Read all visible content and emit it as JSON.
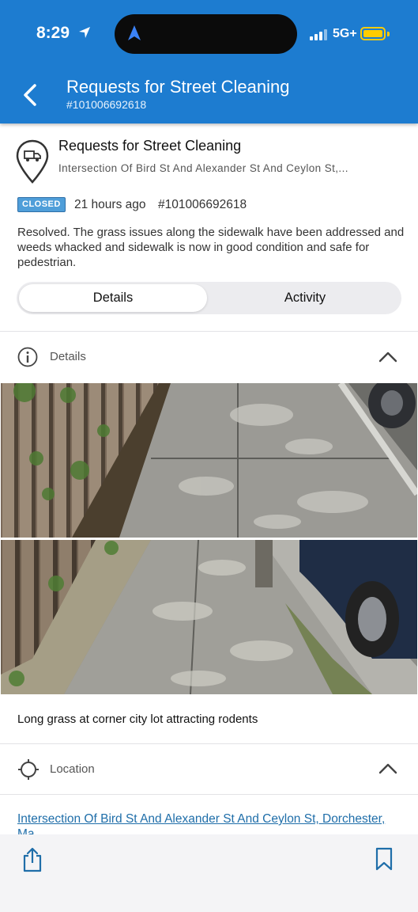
{
  "status_bar": {
    "time": "8:29",
    "network": "5G+"
  },
  "header": {
    "title": "Requests for Street Cleaning",
    "subtitle": "#101006692618"
  },
  "request": {
    "title": "Requests for Street Cleaning",
    "address": "Intersection Of Bird St And Alexander St And Ceylon St,...",
    "status_badge": "CLOSED",
    "time_ago": "21 hours ago",
    "request_id": "#101006692618",
    "resolution_text": "Resolved. The grass issues along the sidewalk  have been addressed and weeds whacked  and sidewalk  is now in good condition and safe for pedestrian."
  },
  "tabs": {
    "details": "Details",
    "activity": "Activity"
  },
  "details_section": {
    "label": "Details",
    "caption": "Long grass at corner city lot attracting rodents"
  },
  "location_section": {
    "label": "Location",
    "address_link": "Intersection Of Bird St And Alexander St And Ceylon St, Dorchester, Ma"
  },
  "colors": {
    "header_bg": "#1d7cd0",
    "badge_bg": "#4f9ed9",
    "link": "#1f6ea9",
    "battery": "#ffcc00"
  },
  "icons": {
    "back": "chevron-left-icon",
    "location_arrow": "location-arrow-icon",
    "pin": "truck-pin-icon",
    "info": "info-circle-icon",
    "crosshair": "crosshair-icon",
    "collapse": "chevron-up-icon",
    "share": "share-icon",
    "bookmark": "bookmark-icon"
  }
}
